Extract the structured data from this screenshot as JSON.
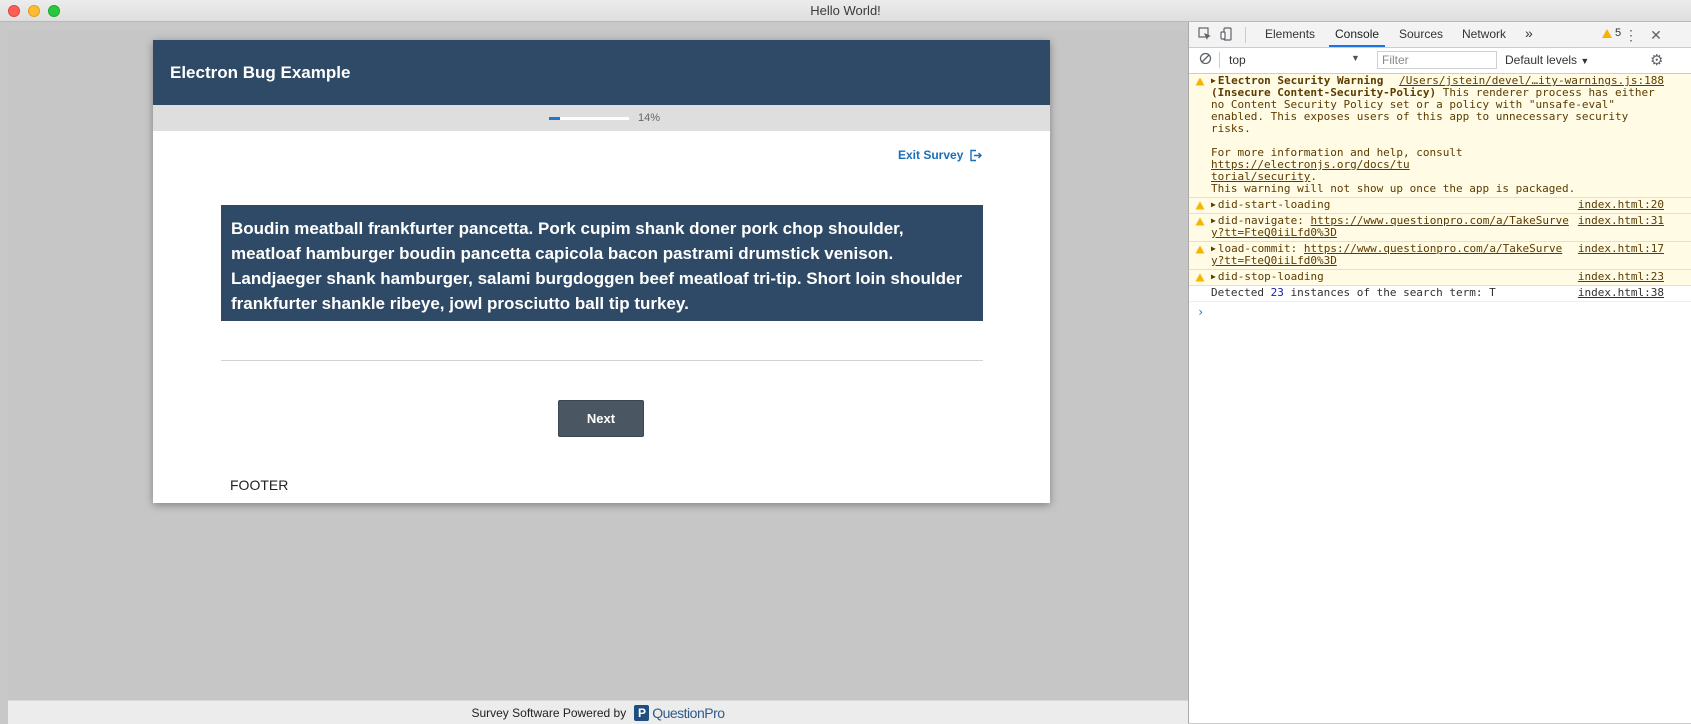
{
  "window": {
    "title": "Hello World!"
  },
  "survey": {
    "header_title": "Electron Bug Example",
    "progress": {
      "percent_label": "14%",
      "fraction": 0.14
    },
    "exit_label": "Exit Survey",
    "question_text": "Boudin meatball frankfurter pancetta. Pork cupim shank doner pork chop shoulder, meatloaf hamburger boudin pancetta capicola bacon pastrami drumstick venison. Landjaeger shank hamburger, salami burgdoggen beef meatloaf tri-tip. Short loin shoulder frankfurter shankle ribeye, jowl prosciutto ball tip turkey.",
    "next_label": "Next",
    "footer_label": "FOOTER",
    "powered_by": "Survey Software Powered by",
    "logo_text": "QuestionPro"
  },
  "devtools": {
    "tabs": [
      "Elements",
      "Console",
      "Sources",
      "Network"
    ],
    "more": "»",
    "warning_count": "5",
    "context": "top",
    "filter_placeholder": "Filter",
    "levels": "Default levels",
    "messages": {
      "security": {
        "head": "Electron Security Warning",
        "src": "/Users/jstein/devel/…ity-warnings.js:188",
        "line1_bold": "(Insecure Content-Security-Policy)",
        "line1_rest": " This renderer process has either",
        "line2": "no Content Security Policy set or a policy with \"unsafe-eval\"",
        "line3": "enabled. This exposes users of this app to unnecessary security",
        "line4": "risks.",
        "line5_pre": "For more information and help, consult ",
        "line5_link": "https://electronjs.org/docs/tu",
        "line6_link": "torial/security",
        "line6_post": ".",
        "line7": "This warning will not show up once the app is packaged."
      },
      "start": {
        "text": "did-start-loading",
        "src": "index.html:20"
      },
      "navigate": {
        "text": "did-navigate: ",
        "link1": "https://www.questionpro.com/a/TakeSurve",
        "link2": "y?tt=FteQ0iiLfd0%3D",
        "src": "index.html:31"
      },
      "commit": {
        "text": "load-commit: ",
        "link1": "https://www.questionpro.com/a/TakeSurve",
        "link2": "y?tt=FteQ0iiLfd0%3D",
        "src": "index.html:17"
      },
      "stop": {
        "text": "did-stop-loading",
        "src": "index.html:23"
      },
      "detected": {
        "pre": "Detected ",
        "count": "23",
        "post": " instances of the search term: T",
        "src": "index.html:38"
      }
    },
    "prompt": "›"
  }
}
